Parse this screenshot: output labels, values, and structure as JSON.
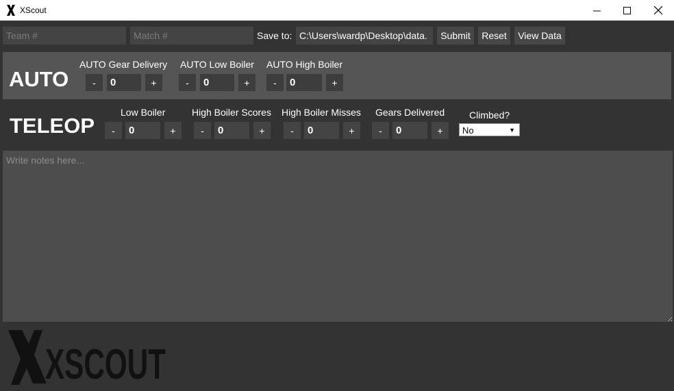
{
  "window": {
    "title": "XScout",
    "icon": "xscout-app-icon",
    "controls": [
      "minimize-icon",
      "maximize-icon",
      "close-icon"
    ]
  },
  "topbar": {
    "team_placeholder": "Team #",
    "match_placeholder": "Match #",
    "save_label": "Save to:",
    "save_path": "C:\\Users\\wardp\\Desktop\\data.",
    "submit_label": "Submit",
    "reset_label": "Reset",
    "view_data_label": "View Data"
  },
  "auto": {
    "title": "AUTO",
    "counters": [
      {
        "label": "AUTO Gear Delivery",
        "value": "0",
        "minus": "-",
        "plus": "+"
      },
      {
        "label": "AUTO Low Boiler",
        "value": "0",
        "minus": "-",
        "plus": "+"
      },
      {
        "label": "AUTO High Boiler",
        "value": "0",
        "minus": "-",
        "plus": "+"
      }
    ]
  },
  "teleop": {
    "title": "TELEOP",
    "counters": [
      {
        "label": "Low Boiler",
        "value": "0",
        "minus": "-",
        "plus": "+"
      },
      {
        "label": "High Boiler Scores",
        "value": "0",
        "minus": "-",
        "plus": "+"
      },
      {
        "label": "High Boiler Misses",
        "value": "0",
        "minus": "-",
        "plus": "+"
      },
      {
        "label": "Gears Delivered",
        "value": "0",
        "minus": "-",
        "plus": "+"
      }
    ],
    "climbed": {
      "label": "Climbed?",
      "selected": "No"
    }
  },
  "notes": {
    "placeholder": "Write notes here..."
  },
  "logo": {
    "text": "XSCOUT"
  },
  "colors": {
    "background": "#333333",
    "auto_panel": "#555555",
    "field": "#444444",
    "notes": "#4d4d4d"
  }
}
